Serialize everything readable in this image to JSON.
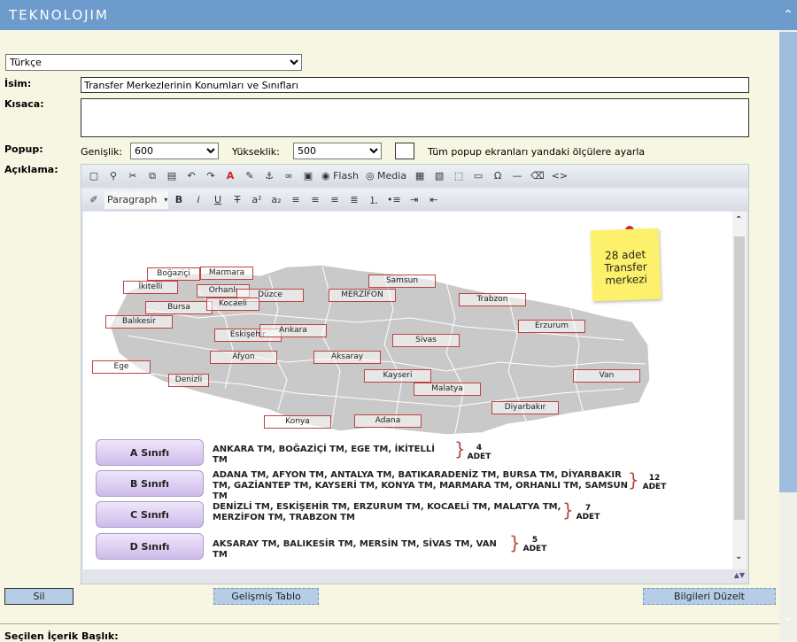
{
  "header": {
    "logo": "TEKNOLOJIM"
  },
  "language": {
    "selected": "Türkçe"
  },
  "labels": {
    "isim": "İsim:",
    "kisaca": "Kısaca:",
    "popup": "Popup:",
    "aciklama": "Açıklama:",
    "secilen": "Seçilen İçerik Başlık:"
  },
  "isim_value": "Transfer Merkezlerinin Konumları ve Sınıfları",
  "kisaca_value": "",
  "popup": {
    "width_label": "Genişlik:",
    "width_value": "600",
    "height_label": "Yükseklik:",
    "height_value": "500",
    "apply_all_label": "Tüm popup ekranları yandaki ölçülere ayarla"
  },
  "toolbar": {
    "flash": "Flash",
    "media": "Media",
    "format": "Paragraph"
  },
  "map": {
    "note": "28 adet Transfer merkezi",
    "cities": [
      "Boğaziçi",
      "Marmara",
      "İkitelli",
      "Orhanlı",
      "Düzce",
      "Samsun",
      "MERZİFON",
      "Trabzon",
      "Bursa",
      "Kocaeli",
      "Balıkesir",
      "Eskişehir",
      "Ankara",
      "Erzurum",
      "Sivas",
      "Afyon",
      "Aksaray",
      "Ege",
      "Denizli",
      "Kayseri",
      "Van",
      "Malatya",
      "Diyarbakır",
      "Konya",
      "Adana"
    ]
  },
  "classes": [
    {
      "name": "A Sınıfı",
      "text": "ANKARA TM, BOĞAZİÇİ TM, EGE TM, İKİTELLİ TM",
      "count": "4",
      "unit": "ADET"
    },
    {
      "name": "B Sınıfı",
      "text": "ADANA TM, AFYON TM, ANTALYA TM, BATIKARADENİZ TM, BURSA TM, DİYARBAKIR TM, GAZİANTEP TM, KAYSERİ TM, KONYA TM, MARMARA TM, ORHANLI TM, SAMSUN TM",
      "count": "12",
      "unit": "ADET"
    },
    {
      "name": "C Sınıfı",
      "text": "DENİZLİ TM, ESKİŞEHİR TM, ERZURUM TM, KOCAELİ TM, MALATYA TM, MERZİFON TM, TRABZON TM",
      "count": "7",
      "unit": "ADET"
    },
    {
      "name": "D Sınıfı",
      "text": "AKSARAY TM, BALIKESİR TM, MERSİN TM, SİVAS TM, VAN TM",
      "count": "5",
      "unit": "ADET"
    }
  ],
  "buttons": {
    "sil": "Sil",
    "gelismis_tablo": "Gelişmiş Tablo",
    "bilgileri_duzelt": "Bilgileri Düzelt"
  }
}
